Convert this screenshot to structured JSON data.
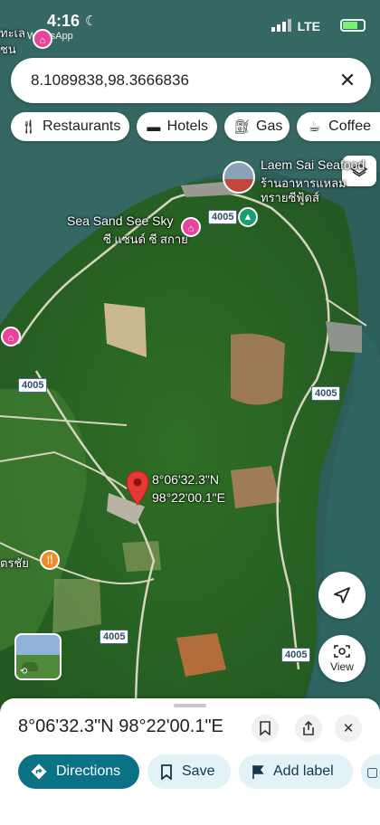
{
  "status_bar": {
    "time": "4:16",
    "carrier_app": "WhatsApp",
    "network": "LTE"
  },
  "search": {
    "query": "8.1089838,98.3666836"
  },
  "chips": [
    {
      "label": "Restaurants",
      "icon": "fork-knife-icon"
    },
    {
      "label": "Hotels",
      "icon": "bed-icon"
    },
    {
      "label": "Gas",
      "icon": "gas-pump-icon"
    },
    {
      "label": "Coffee",
      "icon": "coffee-cup-icon"
    }
  ],
  "map": {
    "labels": {
      "top_left_thai_1": "ทะเล",
      "top_left_thai_2": "ชน",
      "laem_sai_en": "Laem Sai Seafood",
      "laem_sai_th_1": "ร้านอาหารแหลม",
      "laem_sai_th_2": "ทรายซีฟู้ดส์",
      "sea_sand_en": "Sea Sand See Sky",
      "sea_sand_th": "ซี แซนด์ ซี สกาย",
      "left_thai": "ตรชัย",
      "pin_lat": "8°06'32.3\"N",
      "pin_lng": "98°22'00.1\"E"
    },
    "road_shields": [
      "4005",
      "4005",
      "4005",
      "4005",
      "4005"
    ],
    "view_label": "View"
  },
  "sheet": {
    "title": "8°06'32.3\"N 98°22'00.1\"E",
    "actions": [
      {
        "label": "Directions",
        "icon": "directions-icon"
      },
      {
        "label": "Save",
        "icon": "bookmark-icon"
      },
      {
        "label": "Add label",
        "icon": "flag-icon"
      }
    ]
  },
  "colors": {
    "accent": "#0b7285",
    "pin_red": "#e53935",
    "poi_pink": "#e6449d",
    "sea": "#2f5f5b",
    "land": "#2e6b2a"
  }
}
